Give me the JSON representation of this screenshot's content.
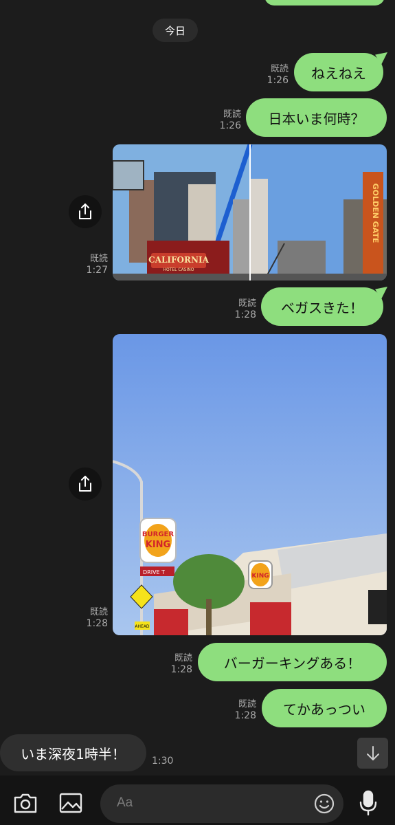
{
  "chat": {
    "date_label": "今日",
    "messages": [
      {
        "read": "既読",
        "time": "1:26",
        "text": "ねえねえ"
      },
      {
        "read": "既読",
        "time": "1:26",
        "text": "日本いま何時？"
      },
      {
        "read": "既読",
        "time": "1:27",
        "kind": "photo"
      },
      {
        "read": "既読",
        "time": "1:28",
        "text": "ベガスきた！"
      },
      {
        "read": "既読",
        "time": "1:28",
        "kind": "photo"
      },
      {
        "read": "既読",
        "time": "1:28",
        "text": "バーガーキングある！"
      },
      {
        "read": "既読",
        "time": "1:28",
        "text": "てかあっつい"
      }
    ],
    "incoming": {
      "text": "いま深夜1時半！",
      "time": "1:30"
    },
    "photo1_signs": {
      "left": "CALIFORNIA",
      "left_sub": "HOTEL CASINO",
      "right": "GOLDEN GATE"
    },
    "photo2_signs": {
      "pole": "BURGER KING",
      "building": "BURGER KING",
      "drive": "DRIVE T",
      "ahead": "AHEAD"
    }
  },
  "composer": {
    "placeholder": "Aa"
  },
  "icons": {
    "share": "share-icon",
    "camera": "camera-icon",
    "gallery": "image-icon",
    "emoji": "emoji-icon",
    "mic": "microphone-icon",
    "scroll_down": "arrow-down-icon"
  },
  "colors": {
    "background": "#1c1c1c",
    "outgoing_bubble": "#8ede7e",
    "incoming_bubble": "#2f2f2f",
    "meta_text": "#a9a9a9"
  }
}
